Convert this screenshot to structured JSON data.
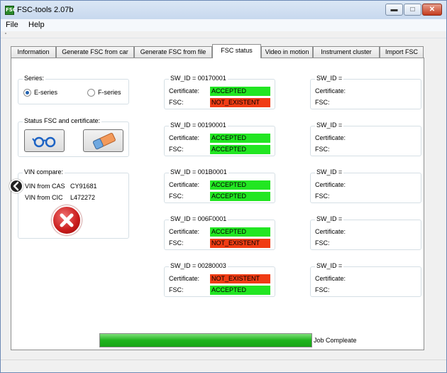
{
  "window": {
    "title": "FSC-tools 2.07b",
    "icon_text": "FSC"
  },
  "menu": [
    "File",
    "Help"
  ],
  "tabs": [
    "Information",
    "Generate FSC from car",
    "Generate FSC from file",
    "FSC status",
    "Video in motion",
    "Instrument cluster",
    "Import FSC"
  ],
  "active_tab": "FSC status",
  "series": {
    "title": "Series:",
    "options": [
      {
        "label": "E-series",
        "selected": true
      },
      {
        "label": "F-series",
        "selected": false
      }
    ]
  },
  "status_fsc": {
    "title": "Status FSC and certificate:"
  },
  "vin_compare": {
    "title": "VIN compare:",
    "cas_label": "VIN from CAS",
    "cas_value": "CY91681",
    "cic_label": "VIN from CIC",
    "cic_value": "L472272"
  },
  "labels": {
    "certificate": "Certificate:",
    "fsc": "FSC:"
  },
  "sw_left": [
    {
      "title": "SW_ID = 00170001",
      "certificate": "ACCEPTED",
      "certificate_color": "#22e622",
      "fsc": "NOT_EXISTENT",
      "fsc_color": "#f03c14"
    },
    {
      "title": "SW_ID = 00190001",
      "certificate": "ACCEPTED",
      "certificate_color": "#22e622",
      "fsc": "ACCEPTED",
      "fsc_color": "#22e622"
    },
    {
      "title": "SW_ID = 001B0001",
      "certificate": "ACCEPTED",
      "certificate_color": "#22e622",
      "fsc": "ACCEPTED",
      "fsc_color": "#22e622"
    },
    {
      "title": "SW_ID = 006F0001",
      "certificate": "ACCEPTED",
      "certificate_color": "#22e622",
      "fsc": "NOT_EXISTENT",
      "fsc_color": "#f03c14"
    },
    {
      "title": "SW_ID = 00280003",
      "certificate": "NOT_EXISTENT",
      "certificate_color": "#f03c14",
      "fsc": "ACCEPTED",
      "fsc_color": "#22e622"
    }
  ],
  "sw_right": [
    {
      "title": "SW_ID ="
    },
    {
      "title": "SW_ID ="
    },
    {
      "title": "SW_ID ="
    },
    {
      "title": "SW_ID ="
    },
    {
      "title": "SW_ID ="
    }
  ],
  "progress": {
    "value": 1.0,
    "text": "Job Compleate"
  },
  "icons": {
    "read": "glasses-icon",
    "erase": "eraser-icon",
    "back": "chevron-left-icon",
    "error": "error-x-icon"
  }
}
